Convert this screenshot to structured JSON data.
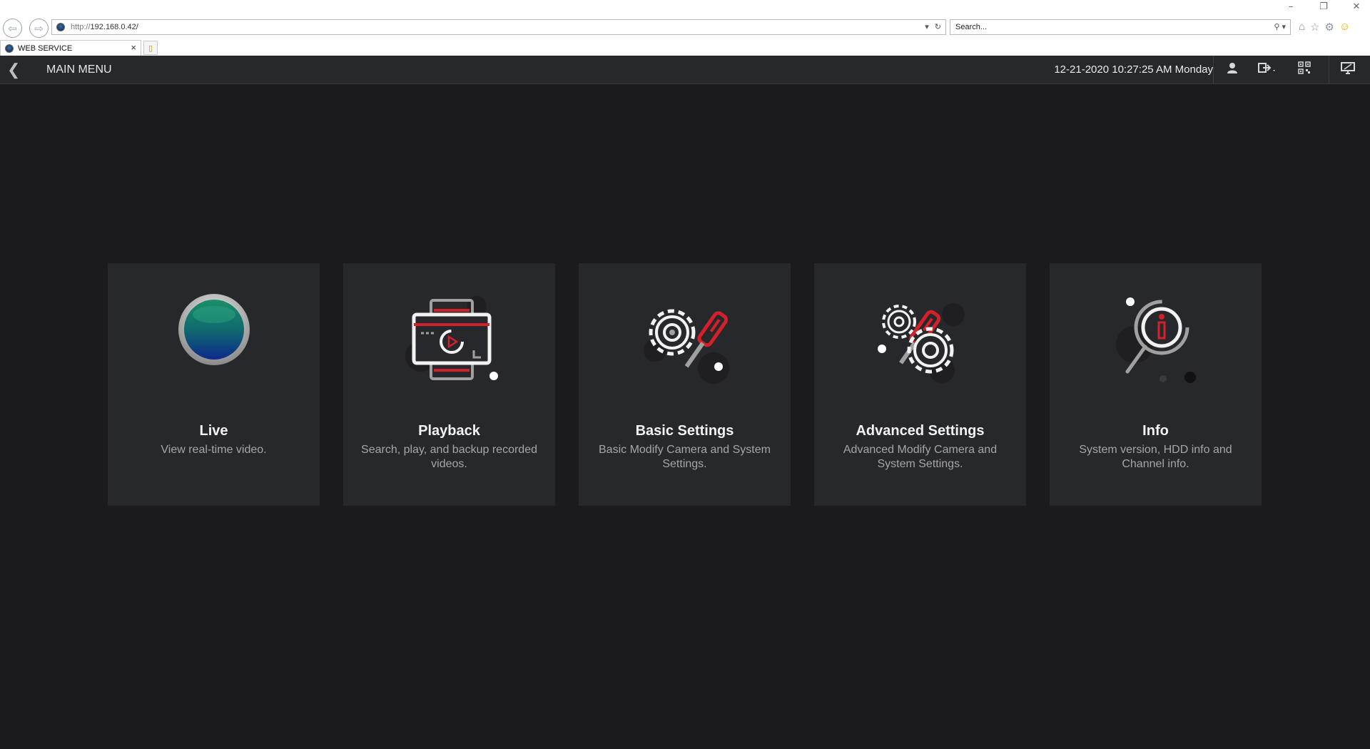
{
  "browser": {
    "address_prefix": "http://",
    "address_host": "192.168.0.42/",
    "search_placeholder": "Search...",
    "tab_title": "WEB SERVICE"
  },
  "header": {
    "title": "MAIN MENU",
    "datetime": "12-21-2020 10:27:25 AM Monday"
  },
  "colors": {
    "background": "#1b1b1d",
    "card": "#27282b",
    "accent_red": "#d4202a"
  },
  "cards": [
    {
      "title": "Live",
      "description": "View real-time video.",
      "icon": "live-lens-icon"
    },
    {
      "title": "Playback",
      "description": "Search, play, and backup recorded videos.",
      "icon": "playback-icon"
    },
    {
      "title": "Basic Settings",
      "description": "Basic Modify Camera and System Settings.",
      "icon": "basic-settings-icon"
    },
    {
      "title": "Advanced Settings",
      "description": "Advanced Modify Camera and System Settings.",
      "icon": "advanced-settings-icon"
    },
    {
      "title": "Info",
      "description": "System version, HDD info and Channel info.",
      "icon": "info-icon"
    }
  ]
}
